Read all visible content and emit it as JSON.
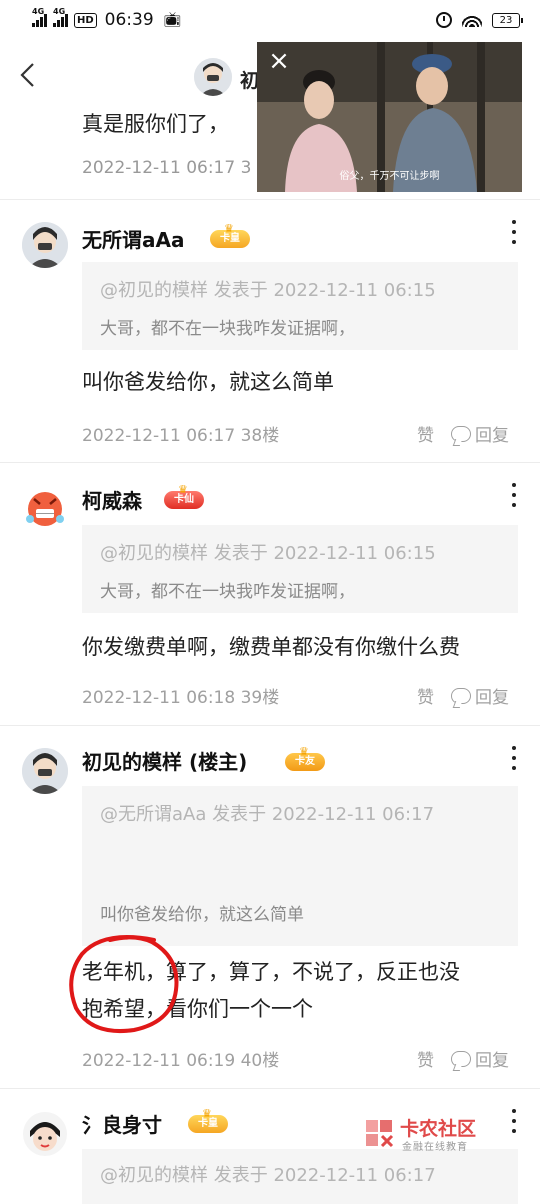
{
  "status_bar": {
    "network_1": "4G",
    "network_2": "4G",
    "hd_label": "HD",
    "time": "06:39",
    "battery": "23"
  },
  "header": {
    "title_partial": "初"
  },
  "video": {
    "subtitle": "俗父，千万不可让步啊"
  },
  "partial_post": {
    "text": "真是服你们了，",
    "meta": "2022-12-11 06:17  3"
  },
  "posts": [
    {
      "author": "无所谓aAa",
      "badge": "卡皇",
      "badge_color": "#f5a623",
      "quote_head": "@初见的模样 发表于 2022-12-11 06:15",
      "quote_text": "大哥，都不在一块我咋发证据啊，",
      "body_lines": [
        "叫你爸发给你，就这么简单"
      ],
      "time": "2022-12-11 06:17",
      "floor": "38楼"
    },
    {
      "author": "柯威森",
      "badge": "卡仙",
      "badge_color": "#e02e24",
      "quote_head": "@初见的模样 发表于 2022-12-11 06:15",
      "quote_text": "大哥，都不在一块我咋发证据啊，",
      "body_lines": [
        "你发缴费单啊，缴费单都没有你缴什么费"
      ],
      "time": "2022-12-11 06:18",
      "floor": "39楼"
    },
    {
      "author": "初见的模样 (楼主)",
      "badge": "卡友",
      "badge_color": "#f29a16",
      "quote_head": "@无所谓aAa 发表于 2022-12-11 06:17",
      "quote_text": "叫你爸发给你，就这么简单",
      "body_lines": [
        "老年机，算了，算了，不说了，反正也没",
        "抱希望，看你们一个一个"
      ],
      "time": "2022-12-11 06:19",
      "floor": "40楼"
    },
    {
      "author": "氵良身寸",
      "badge": "卡皇",
      "badge_color": "#f5a623",
      "quote_head": "@初见的模样 发表于 2022-12-11 06:17"
    }
  ],
  "actions": {
    "like": "赞",
    "reply": "回复"
  },
  "watermark": {
    "title": "卡农社区",
    "subtitle": "金融在线教育"
  },
  "accent_color": "#e02e24"
}
